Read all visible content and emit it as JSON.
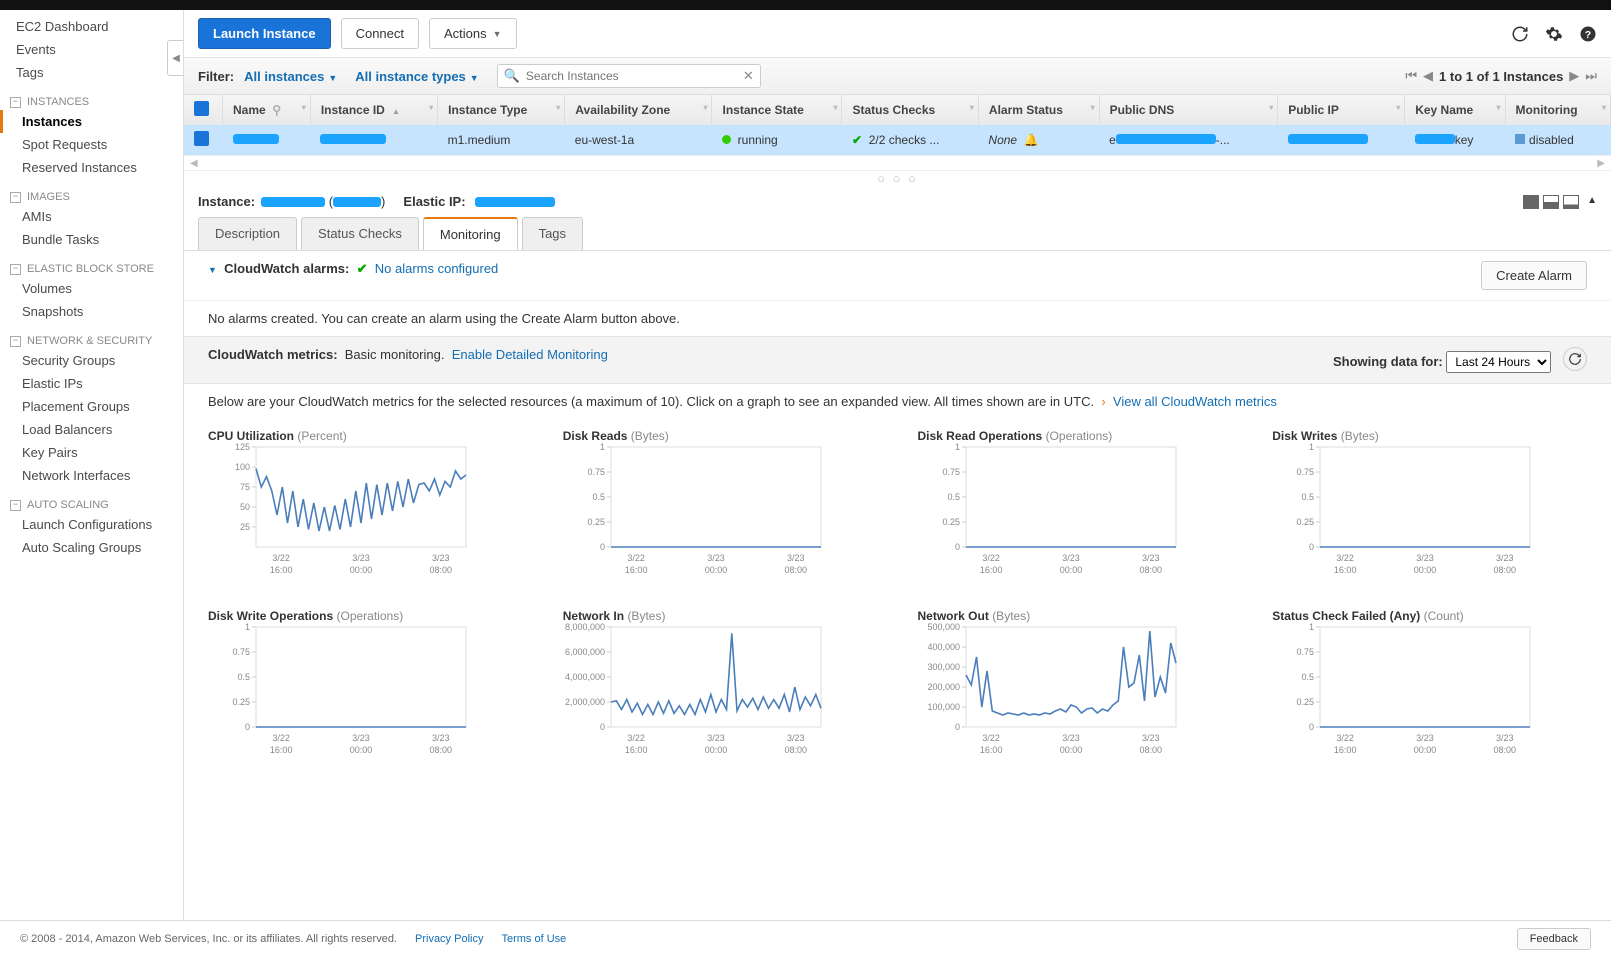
{
  "sidebar": {
    "top": [
      "EC2 Dashboard",
      "Events",
      "Tags"
    ],
    "groups": [
      {
        "label": "INSTANCES",
        "items": [
          "Instances",
          "Spot Requests",
          "Reserved Instances"
        ],
        "selected": 0
      },
      {
        "label": "IMAGES",
        "items": [
          "AMIs",
          "Bundle Tasks"
        ]
      },
      {
        "label": "ELASTIC BLOCK STORE",
        "items": [
          "Volumes",
          "Snapshots"
        ]
      },
      {
        "label": "NETWORK & SECURITY",
        "items": [
          "Security Groups",
          "Elastic IPs",
          "Placement Groups",
          "Load Balancers",
          "Key Pairs",
          "Network Interfaces"
        ]
      },
      {
        "label": "AUTO SCALING",
        "items": [
          "Launch Configurations",
          "Auto Scaling Groups"
        ]
      }
    ]
  },
  "actions": {
    "launch": "Launch Instance",
    "connect": "Connect",
    "actions": "Actions"
  },
  "filter": {
    "label": "Filter:",
    "all_instances": "All instances",
    "all_types": "All instance types",
    "search_placeholder": "Search Instances",
    "pager": "1 to 1 of 1 Instances"
  },
  "columns": [
    "",
    "Name",
    "Instance ID",
    "Instance Type",
    "Availability Zone",
    "Instance State",
    "Status Checks",
    "Alarm Status",
    "Public DNS",
    "Public IP",
    "Key Name",
    "Monitoring"
  ],
  "row": {
    "type": "m1.medium",
    "az": "eu-west-1a",
    "state": "running",
    "status": "2/2 checks ...",
    "alarm": "None",
    "keysuffix": "key",
    "monitoring": "disabled"
  },
  "details": {
    "instance_lbl": "Instance:",
    "elastic_lbl": "Elastic IP:"
  },
  "tabs": [
    "Description",
    "Status Checks",
    "Monitoring",
    "Tags"
  ],
  "alarms": {
    "label": "CloudWatch alarms:",
    "msg": "No alarms configured",
    "create_btn": "Create Alarm",
    "info": "No alarms created. You can create an alarm using the Create Alarm button above."
  },
  "metricsbar": {
    "label": "CloudWatch metrics:",
    "mode": "Basic monitoring.",
    "enable": "Enable Detailed Monitoring",
    "showing": "Showing data for:",
    "period": "Last 24 Hours"
  },
  "metricsinfo": "Below are your CloudWatch metrics for the selected resources (a maximum of 10). Click on a graph to see an expanded view. All times shown are in UTC.",
  "view_all": "View all CloudWatch metrics",
  "xticks": [
    {
      "t": "3/22",
      "s": "16:00"
    },
    {
      "t": "3/23",
      "s": "00:00"
    },
    {
      "t": "3/23",
      "s": "08:00"
    }
  ],
  "chart_data": [
    {
      "title": "CPU Utilization",
      "unit": "(Percent)",
      "type": "line",
      "ylim": [
        0,
        125
      ],
      "yticks": [
        25,
        50,
        75,
        100,
        125
      ],
      "values": [
        98,
        75,
        88,
        70,
        40,
        75,
        30,
        70,
        25,
        60,
        22,
        55,
        20,
        50,
        20,
        52,
        22,
        60,
        25,
        70,
        30,
        80,
        35,
        78,
        40,
        80,
        45,
        82,
        50,
        85,
        55,
        78,
        80,
        70,
        85,
        65,
        82,
        75,
        95,
        85,
        90
      ]
    },
    {
      "title": "Disk Reads",
      "unit": "(Bytes)",
      "type": "line",
      "ylim": [
        0,
        1
      ],
      "yticks": [
        0,
        0.25,
        0.5,
        0.75,
        1
      ],
      "values": [
        0,
        0,
        0,
        0,
        0,
        0,
        0,
        0,
        0,
        0,
        0,
        0,
        0,
        0,
        0,
        0,
        0,
        0,
        0,
        0,
        0,
        0,
        0,
        0,
        0,
        0,
        0,
        0,
        0,
        0,
        0,
        0,
        0,
        0,
        0,
        0,
        0,
        0,
        0,
        0,
        0
      ]
    },
    {
      "title": "Disk Read Operations",
      "unit": "(Operations)",
      "type": "line",
      "ylim": [
        0,
        1
      ],
      "yticks": [
        0,
        0.25,
        0.5,
        0.75,
        1
      ],
      "values": [
        0,
        0,
        0,
        0,
        0,
        0,
        0,
        0,
        0,
        0,
        0,
        0,
        0,
        0,
        0,
        0,
        0,
        0,
        0,
        0,
        0,
        0,
        0,
        0,
        0,
        0,
        0,
        0,
        0,
        0,
        0,
        0,
        0,
        0,
        0,
        0,
        0,
        0,
        0,
        0,
        0
      ]
    },
    {
      "title": "Disk Writes",
      "unit": "(Bytes)",
      "type": "line",
      "ylim": [
        0,
        1
      ],
      "yticks": [
        0,
        0.25,
        0.5,
        0.75,
        1
      ],
      "values": [
        0,
        0,
        0,
        0,
        0,
        0,
        0,
        0,
        0,
        0,
        0,
        0,
        0,
        0,
        0,
        0,
        0,
        0,
        0,
        0,
        0,
        0,
        0,
        0,
        0,
        0,
        0,
        0,
        0,
        0,
        0,
        0,
        0,
        0,
        0,
        0,
        0,
        0,
        0,
        0,
        0
      ]
    },
    {
      "title": "Disk Write Operations",
      "unit": "(Operations)",
      "type": "line",
      "ylim": [
        0,
        1
      ],
      "yticks": [
        0,
        0.25,
        0.5,
        0.75,
        1
      ],
      "values": [
        0,
        0,
        0,
        0,
        0,
        0,
        0,
        0,
        0,
        0,
        0,
        0,
        0,
        0,
        0,
        0,
        0,
        0,
        0,
        0,
        0,
        0,
        0,
        0,
        0,
        0,
        0,
        0,
        0,
        0,
        0,
        0,
        0,
        0,
        0,
        0,
        0,
        0,
        0,
        0,
        0
      ]
    },
    {
      "title": "Network In",
      "unit": "(Bytes)",
      "type": "line",
      "ylim": [
        0,
        8000000
      ],
      "yticks": [
        0,
        2000000,
        4000000,
        6000000,
        8000000
      ],
      "yfmt": "comma",
      "values": [
        2000000,
        2100000,
        1400000,
        2200000,
        1200000,
        1900000,
        1000000,
        1800000,
        1000000,
        2000000,
        1100000,
        2100000,
        1100000,
        1700000,
        1000000,
        1800000,
        1000000,
        2200000,
        1200000,
        2600000,
        1200000,
        2200000,
        1400000,
        7500000,
        1300000,
        2200000,
        1600000,
        2300000,
        1400000,
        2400000,
        1500000,
        2200000,
        1500000,
        2600000,
        1200000,
        3200000,
        1400000,
        2400000,
        1700000,
        2600000,
        1500000
      ]
    },
    {
      "title": "Network Out",
      "unit": "(Bytes)",
      "type": "line",
      "ylim": [
        0,
        500000
      ],
      "yticks": [
        0,
        100000,
        200000,
        300000,
        400000,
        500000
      ],
      "yfmt": "comma",
      "values": [
        260000,
        210000,
        350000,
        100000,
        280000,
        80000,
        70000,
        60000,
        70000,
        65000,
        60000,
        70000,
        60000,
        65000,
        60000,
        70000,
        65000,
        80000,
        90000,
        75000,
        110000,
        100000,
        70000,
        90000,
        95000,
        70000,
        90000,
        80000,
        110000,
        130000,
        400000,
        200000,
        220000,
        360000,
        130000,
        480000,
        150000,
        250000,
        170000,
        420000,
        320000
      ]
    },
    {
      "title": "Status Check Failed (Any)",
      "unit": "(Count)",
      "type": "line",
      "ylim": [
        0,
        1
      ],
      "yticks": [
        0,
        0.25,
        0.5,
        0.75,
        1
      ],
      "values": [
        0,
        0,
        0,
        0,
        0,
        0,
        0,
        0,
        0,
        0,
        0,
        0,
        0,
        0,
        0,
        0,
        0,
        0,
        0,
        0,
        0,
        0,
        0,
        0,
        0,
        0,
        0,
        0,
        0,
        0,
        0,
        0,
        0,
        0,
        0,
        0,
        0,
        0,
        0,
        0,
        0
      ]
    }
  ],
  "footer": {
    "copy": "© 2008 - 2014, Amazon Web Services, Inc. or its affiliates. All rights reserved.",
    "privacy": "Privacy Policy",
    "terms": "Terms of Use",
    "feedback": "Feedback"
  }
}
